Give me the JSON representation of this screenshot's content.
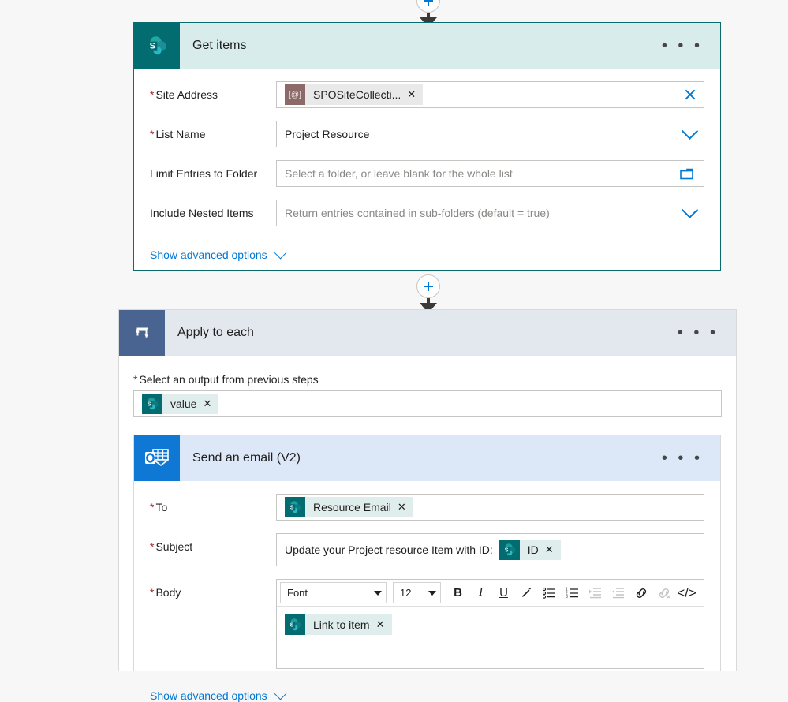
{
  "flow": {
    "connectors": [
      {
        "name": "connector-top",
        "icon": "plus-circle-icon"
      },
      {
        "name": "connector-middle",
        "icon": "plus-circle-icon"
      }
    ],
    "steps": [
      {
        "id": "get-items",
        "title": "Get items",
        "icon": "sharepoint-icon",
        "menu": "• • •",
        "advanced_label": "Show advanced options",
        "fields": [
          {
            "label": "Site Address",
            "required": true,
            "token": {
              "label": "SPOSiteCollecti...",
              "icon": "at-token-icon",
              "remove": "✕"
            },
            "trailing_icon": "clear-x-icon"
          },
          {
            "label": "List Name",
            "required": true,
            "value": "Project Resource",
            "trailing_icon": "chevron-down-icon"
          },
          {
            "label": "Limit Entries to Folder",
            "required": false,
            "placeholder": "Select a folder, or leave blank for the whole list",
            "trailing_icon": "folder-picker-icon"
          },
          {
            "label": "Include Nested Items",
            "required": false,
            "placeholder": "Return entries contained in sub-folders (default = true)",
            "trailing_icon": "chevron-down-icon"
          }
        ]
      },
      {
        "id": "apply-to-each",
        "title": "Apply to each",
        "icon": "loop-icon",
        "menu": "• • •",
        "output_label": "Select an output from previous steps",
        "output_required": true,
        "output_token": {
          "label": "value",
          "icon": "sharepoint-token-icon",
          "remove": "✕"
        }
      },
      {
        "id": "send-email",
        "title": "Send an email (V2)",
        "icon": "outlook-icon",
        "menu": "• • •",
        "advanced_label": "Show advanced options",
        "to": {
          "label": "To",
          "required": true,
          "token": {
            "label": "Resource Email",
            "icon": "sharepoint-token-icon",
            "remove": "✕"
          }
        },
        "subject": {
          "label": "Subject",
          "required": true,
          "text": "Update your Project resource Item with ID:",
          "token": {
            "label": "ID",
            "icon": "sharepoint-token-icon",
            "remove": "✕"
          }
        },
        "body": {
          "label": "Body",
          "required": true,
          "toolbar": {
            "font_name": "Font",
            "font_size": "12",
            "bold": "B",
            "italic": "I",
            "underline": "U",
            "text_color": "text-color-icon",
            "bulleted_list": "bulleted-list-icon",
            "numbered_list": "numbered-list-icon",
            "indent": "indent-icon",
            "outdent": "outdent-icon",
            "link": "link-icon",
            "unlink": "unlink-icon",
            "code_view": "</>"
          },
          "token": {
            "label": "Link to item",
            "icon": "sharepoint-token-icon",
            "remove": "✕"
          }
        }
      }
    ]
  },
  "colors": {
    "sharepoint_teal": "#036c70",
    "outlook_blue": "#0f78d4",
    "loop_slate": "#4a6491",
    "accent_blue": "#0078d4",
    "required_red": "#a4262c",
    "token_bg": "#dfeeed"
  }
}
